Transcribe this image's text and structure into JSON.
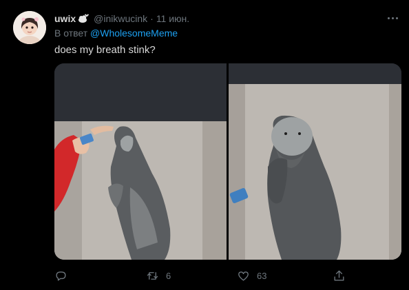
{
  "tweet": {
    "display_name": "uwix",
    "name_emoji": "cloud-with-hearts-emoji",
    "handle": "@inikwucink",
    "separator": "·",
    "date": "11 июн.",
    "reply_prefix": "В ответ",
    "reply_to": "@WholesomeMeme",
    "text": "does my breath stink?",
    "media": {
      "left_image": "otter-sniffing-toothpaste",
      "right_image": "otter-covering-mouth"
    },
    "actions": {
      "reply": {
        "icon": "reply-icon",
        "count": ""
      },
      "retweet": {
        "icon": "retweet-icon",
        "count": "6"
      },
      "like": {
        "icon": "heart-icon",
        "count": "63"
      },
      "share": {
        "icon": "share-icon",
        "count": ""
      }
    }
  },
  "colors": {
    "background": "#000000",
    "text": "#d9d9d9",
    "secondary": "#6e767d",
    "link": "#1da1f2"
  }
}
